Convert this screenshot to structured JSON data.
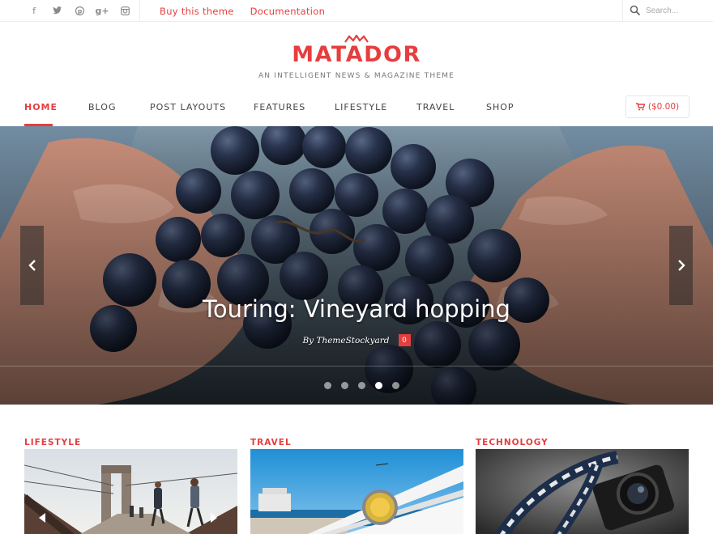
{
  "topbar": {
    "social_icons": [
      "facebook-icon",
      "twitter-icon",
      "pinterest-icon",
      "google-plus-icon",
      "instagram-icon"
    ],
    "links": [
      "Buy this theme",
      "Documentation"
    ],
    "search_placeholder": "Search..."
  },
  "brand": {
    "logo": "MATADOR",
    "tagline": "AN INTELLIGENT NEWS & MAGAZINE THEME",
    "accent_color": "#e63e3e"
  },
  "nav": {
    "items": [
      "HOME",
      "BLOG",
      "POST LAYOUTS",
      "FEATURES",
      "LIFESTYLE",
      "TRAVEL",
      "SHOP"
    ],
    "active": "HOME",
    "cart_label": "($0.00)"
  },
  "hero": {
    "title": "Touring: Vineyard hopping",
    "author": "By ThemeStockyard",
    "comments": "0",
    "slide_count": 5,
    "active_slide": 4
  },
  "categories": [
    {
      "label": "LIFESTYLE"
    },
    {
      "label": "TRAVEL"
    },
    {
      "label": "TECHNOLOGY"
    }
  ]
}
